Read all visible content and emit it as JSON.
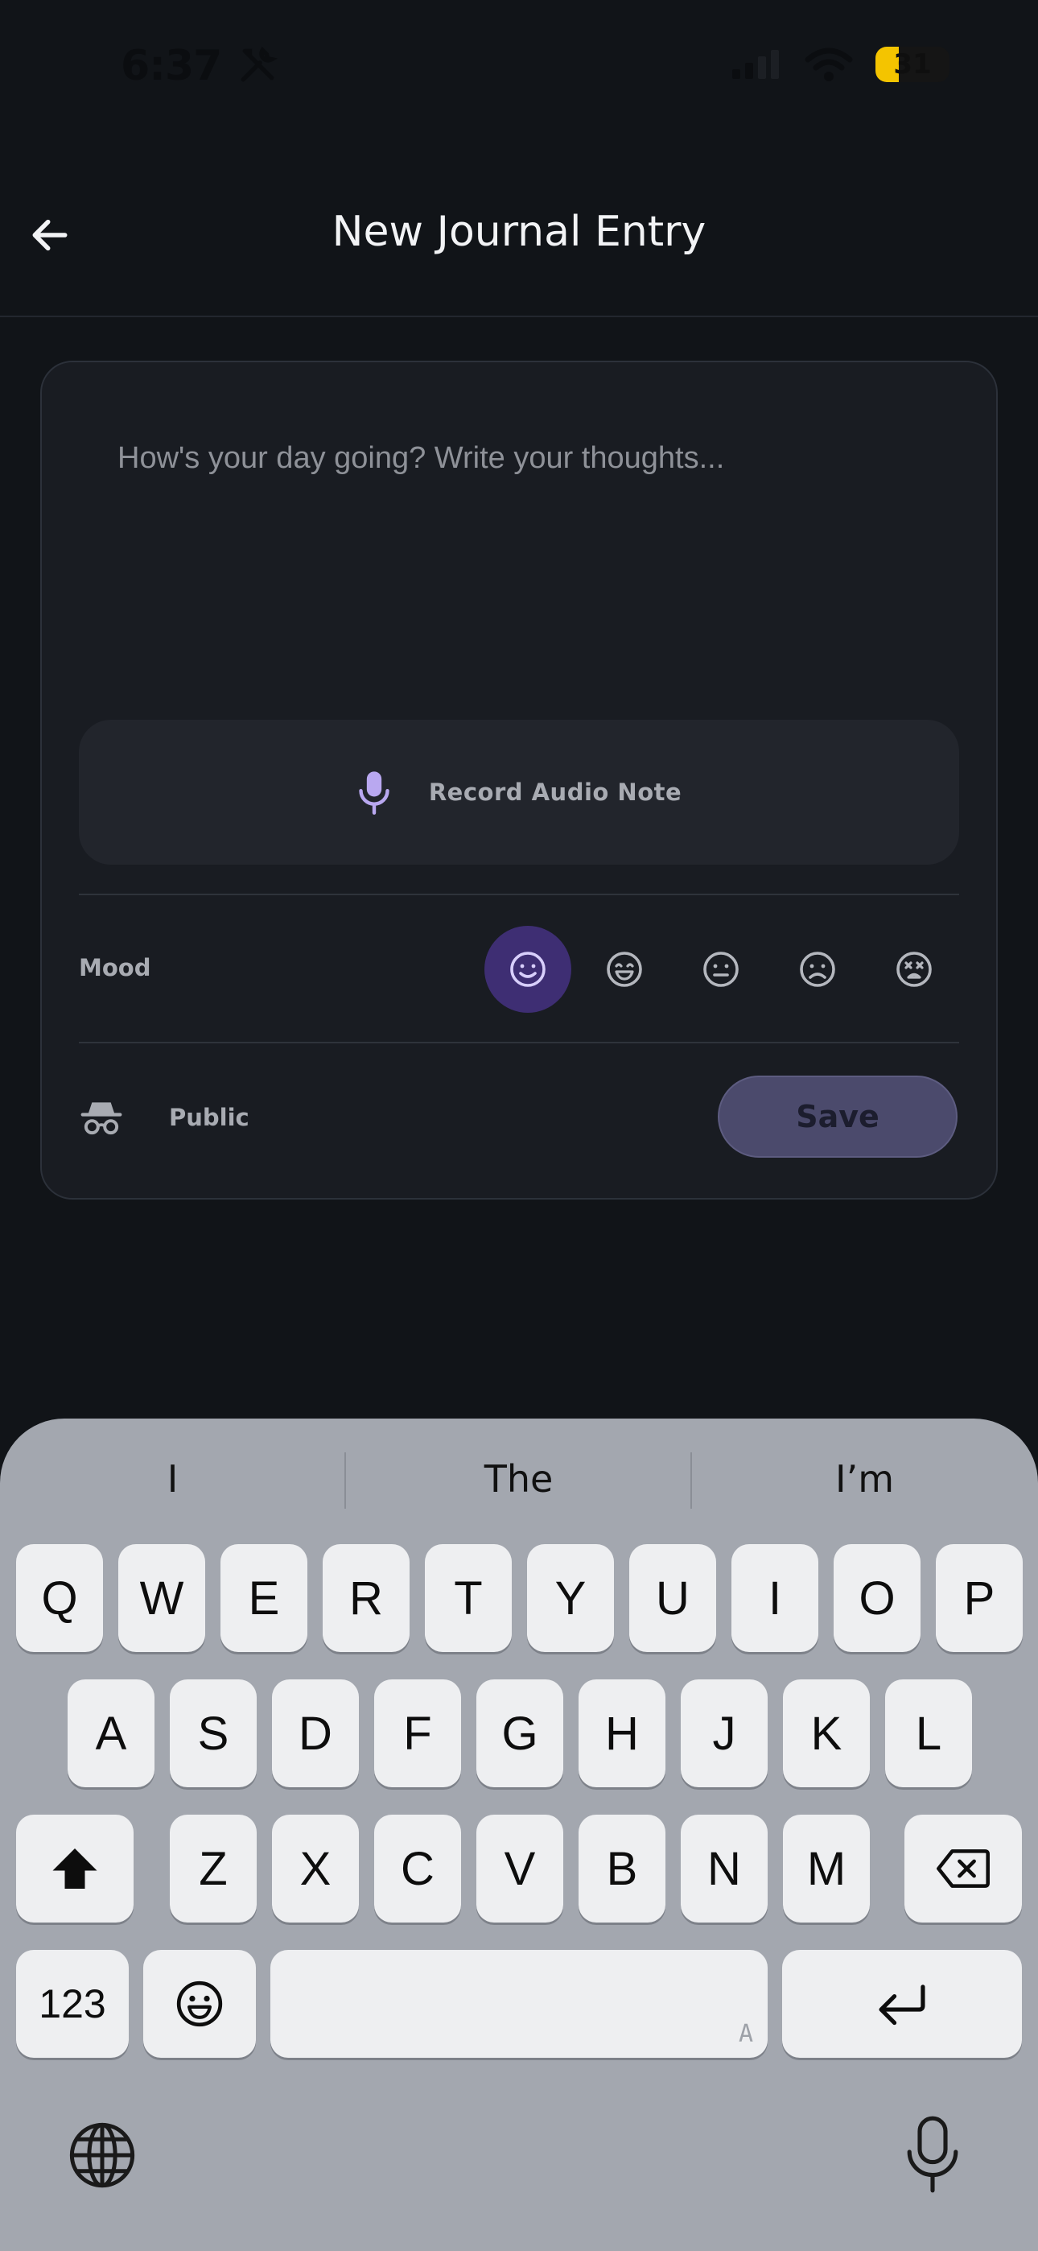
{
  "status_bar": {
    "time": "6:37",
    "battery": "31",
    "battery_color": "#f4c400"
  },
  "header": {
    "title": "New Journal Entry",
    "back_icon": "arrow-left-icon"
  },
  "entry": {
    "placeholder": "How's your day going? Write your thoughts...",
    "value": ""
  },
  "audio": {
    "label": "Record Audio Note",
    "icon": "microphone-icon",
    "icon_color": "#b9a8f0"
  },
  "mood": {
    "label": "Mood",
    "options": [
      "smile",
      "laugh",
      "neutral",
      "sad",
      "dizzy"
    ],
    "selected": "smile",
    "accent": "#3e2e73"
  },
  "visibility": {
    "label": "Public",
    "icon": "incognito-icon"
  },
  "save": {
    "label": "Save"
  },
  "keyboard": {
    "suggestions": [
      "I",
      "The",
      "I’m"
    ],
    "row1": [
      "Q",
      "W",
      "E",
      "R",
      "T",
      "Y",
      "U",
      "I",
      "O",
      "P"
    ],
    "row2": [
      "A",
      "S",
      "D",
      "F",
      "G",
      "H",
      "J",
      "K",
      "L"
    ],
    "row3": [
      "Z",
      "X",
      "C",
      "V",
      "B",
      "N",
      "M"
    ],
    "numbers_key": "123",
    "space_hint": "A"
  }
}
